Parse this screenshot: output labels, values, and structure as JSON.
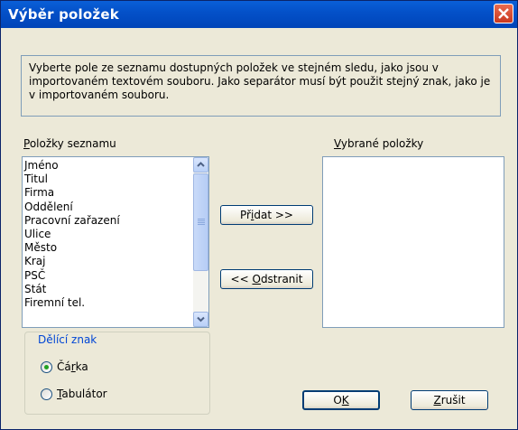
{
  "window": {
    "title": "Výběr položek"
  },
  "info_text": "Vyberte pole ze seznamu dostupných položek ve stejném sledu, jako jsou v importovaném textovém souboru. Jako separátor musí být použit stejný znak, jako je v importovaném souboru.",
  "available": {
    "label_accel": "P",
    "label_rest": "oložky seznamu",
    "items": [
      "Jméno",
      "Titul",
      "Firma",
      "Oddělení",
      "Pracovní zařazení",
      "Ulice",
      "Město",
      "Kraj",
      "PSČ",
      "Stát",
      "Firemní tel."
    ]
  },
  "selected": {
    "label_accel": "V",
    "label_rest": "ybrané položky",
    "items": []
  },
  "buttons": {
    "add": {
      "pre": "Př",
      "accel": "i",
      "post": "dat >>"
    },
    "remove": {
      "pre": "<< ",
      "accel": "O",
      "post": "dstranit"
    },
    "ok": {
      "pre": "O",
      "accel": "K",
      "post": ""
    },
    "cancel": {
      "pre": "",
      "accel": "Z",
      "post": "rušit"
    }
  },
  "separator": {
    "label": "Dělící znak",
    "options": [
      {
        "pre": "Čá",
        "accel": "r",
        "post": "ka",
        "selected": true
      },
      {
        "pre": "",
        "accel": "T",
        "post": "abulátor",
        "selected": false
      }
    ]
  }
}
